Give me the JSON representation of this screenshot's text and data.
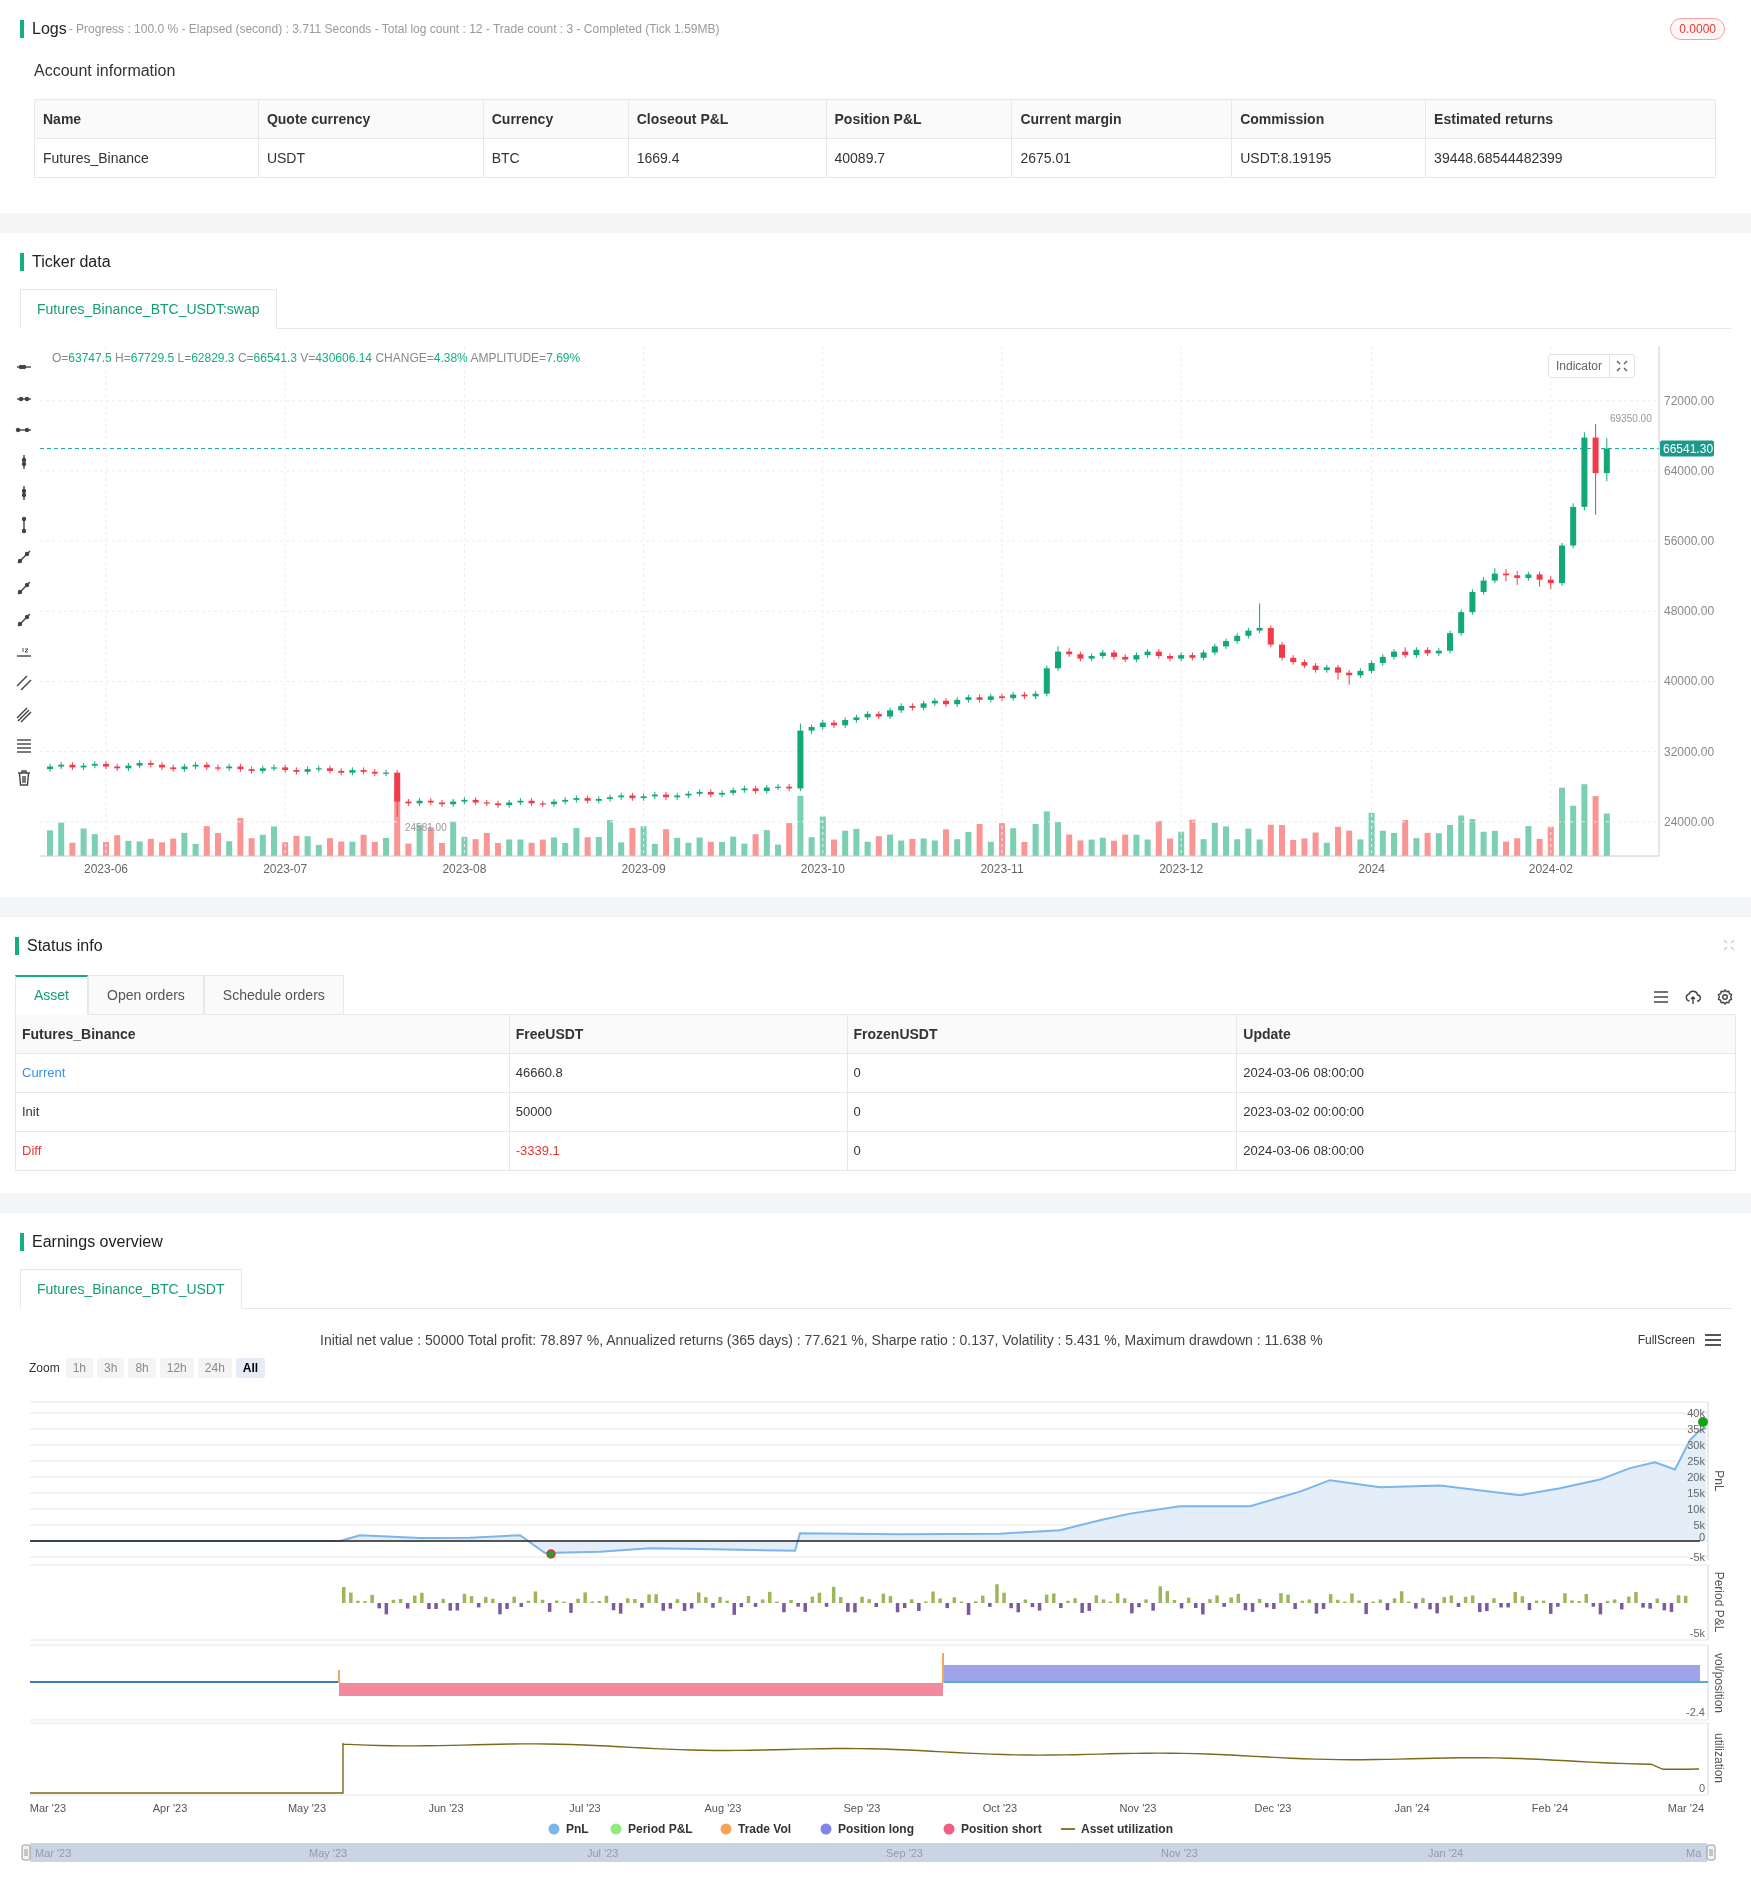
{
  "logs": {
    "title": "Logs",
    "summary": "- Progress : 100.0 % - Elapsed (second) : 3.711  Seconds - Total log count : 12 - Trade count : 3 - Completed (Tick 1.59MB)",
    "badge": "0.0000"
  },
  "account": {
    "title": "Account information",
    "columns": [
      "Name",
      "Quote currency",
      "Currency",
      "Closeout P&L",
      "Position P&L",
      "Current margin",
      "Commission",
      "Estimated returns"
    ],
    "rows": [
      [
        "Futures_Binance",
        "USDT",
        "BTC",
        "1669.4",
        "40089.7",
        "2675.01",
        "USDT:8.19195",
        "39448.68544482399"
      ]
    ]
  },
  "ticker": {
    "title": "Ticker data",
    "tabs": [
      {
        "label": "Futures_Binance_BTC_USDT:swap",
        "selected": true
      }
    ],
    "ohlc": [
      {
        "label": "O=",
        "value": "63747.5"
      },
      {
        "label": "H=",
        "value": "67729.5"
      },
      {
        "label": "L=",
        "value": "62829.3"
      },
      {
        "label": "C=",
        "value": "66541.3"
      },
      {
        "label": "V=",
        "value": "430606.14"
      },
      {
        "label": "CHANGE=",
        "value": "4.38%"
      },
      {
        "label": "AMPLITUDE=",
        "value": "7.69%"
      }
    ],
    "indicator_button": "Indicator",
    "last_price": "66541.30",
    "high_marker": "69350.00",
    "low_marker": "24581.00",
    "chart_data": {
      "type": "candlestick",
      "categories": [
        null,
        null,
        null,
        null,
        null,
        "2023-06",
        null,
        null,
        null,
        null,
        null,
        null,
        null,
        null,
        null,
        null,
        null,
        null,
        null,
        null,
        null,
        "2023-07",
        null,
        null,
        null,
        null,
        null,
        null,
        null,
        null,
        null,
        null,
        null,
        null,
        null,
        null,
        null,
        "2023-08",
        null,
        null,
        null,
        null,
        null,
        null,
        null,
        null,
        null,
        null,
        null,
        null,
        null,
        null,
        null,
        "2023-09",
        null,
        null,
        null,
        null,
        null,
        null,
        null,
        null,
        null,
        null,
        null,
        null,
        null,
        null,
        null,
        "2023-10",
        null,
        null,
        null,
        null,
        null,
        null,
        null,
        null,
        null,
        null,
        null,
        null,
        null,
        null,
        null,
        "2023-11",
        null,
        null,
        null,
        null,
        null,
        null,
        null,
        null,
        null,
        null,
        null,
        null,
        null,
        null,
        null,
        "2023-12",
        null,
        null,
        null,
        null,
        null,
        null,
        null,
        null,
        null,
        null,
        null,
        null,
        null,
        null,
        null,
        null,
        "2024",
        null,
        null,
        null,
        null,
        null,
        null,
        null,
        null,
        null,
        null,
        null,
        null,
        null,
        null,
        null,
        "2024-02",
        null,
        null,
        null,
        null,
        null
      ],
      "ylim": [
        20100,
        78240
      ],
      "grid": true,
      "yticks": [
        {
          "value": 72000,
          "label": "72000.00"
        },
        {
          "value": 64000,
          "label": "64000.00"
        },
        {
          "value": 56000,
          "label": "56000.00"
        },
        {
          "value": 48000,
          "label": "48000.00"
        },
        {
          "value": 40000,
          "label": "40000.00"
        },
        {
          "value": 32000,
          "label": "32000.00"
        },
        {
          "value": 24000,
          "label": "24000.00"
        }
      ],
      "ohlc": [
        [
          30000,
          30600,
          29700,
          30300
        ],
        [
          30300,
          30800,
          30000,
          30500
        ],
        [
          30500,
          30800,
          29900,
          30200
        ],
        [
          30200,
          30700,
          29900,
          30400
        ],
        [
          30400,
          30900,
          30100,
          30600
        ],
        [
          30600,
          30900,
          30000,
          30300
        ],
        [
          30300,
          30600,
          29800,
          30100
        ],
        [
          30100,
          30700,
          29800,
          30400
        ],
        [
          30400,
          31000,
          30100,
          30700
        ],
        [
          30700,
          31000,
          30200,
          30500
        ],
        [
          30500,
          30800,
          29900,
          30200
        ],
        [
          30200,
          30500,
          29700,
          30000
        ],
        [
          30000,
          30600,
          29700,
          30300
        ],
        [
          30300,
          30800,
          30000,
          30500
        ],
        [
          30500,
          30800,
          29900,
          30200
        ],
        [
          30200,
          30500,
          29800,
          30100
        ],
        [
          30100,
          30600,
          29800,
          30300
        ],
        [
          30300,
          30600,
          29700,
          30000
        ],
        [
          30000,
          30300,
          29500,
          29800
        ],
        [
          29800,
          30400,
          29500,
          30100
        ],
        [
          30100,
          30500,
          29800,
          30200
        ],
        [
          30200,
          30500,
          29600,
          29900
        ],
        [
          29900,
          30200,
          29400,
          29700
        ],
        [
          29700,
          30300,
          29400,
          30000
        ],
        [
          30000,
          30400,
          29700,
          30100
        ],
        [
          30100,
          30400,
          29500,
          29800
        ],
        [
          29800,
          30100,
          29300,
          29600
        ],
        [
          29600,
          30200,
          29300,
          29900
        ],
        [
          29900,
          30200,
          29400,
          29700
        ],
        [
          29700,
          30000,
          29200,
          29500
        ],
        [
          29500,
          29900,
          29200,
          29600
        ],
        [
          29600,
          29900,
          24581,
          26300
        ],
        [
          26300,
          26600,
          25800,
          26100
        ],
        [
          26100,
          26700,
          25800,
          26400
        ],
        [
          26400,
          26700,
          25900,
          26200
        ],
        [
          26200,
          26500,
          25700,
          26000
        ],
        [
          26000,
          26600,
          25700,
          26300
        ],
        [
          26300,
          26800,
          26000,
          26500
        ],
        [
          26500,
          26800,
          25900,
          26200
        ],
        [
          26200,
          26500,
          25800,
          26100
        ],
        [
          26100,
          26400,
          25600,
          25900
        ],
        [
          25900,
          26500,
          25600,
          26200
        ],
        [
          26200,
          26700,
          25900,
          26400
        ],
        [
          26400,
          26700,
          25800,
          26100
        ],
        [
          26100,
          26400,
          25700,
          26000
        ],
        [
          26000,
          26600,
          25700,
          26300
        ],
        [
          26300,
          26800,
          26000,
          26500
        ],
        [
          26500,
          27000,
          26200,
          26700
        ],
        [
          26700,
          27000,
          26100,
          26400
        ],
        [
          26400,
          26900,
          26100,
          26600
        ],
        [
          26600,
          27100,
          26300,
          26800
        ],
        [
          26800,
          27300,
          26500,
          27000
        ],
        [
          27000,
          27300,
          26400,
          26700
        ],
        [
          26700,
          27200,
          26400,
          26900
        ],
        [
          26900,
          27400,
          26600,
          27100
        ],
        [
          27100,
          27400,
          26500,
          26800
        ],
        [
          26800,
          27300,
          26500,
          27000
        ],
        [
          27000,
          27500,
          26700,
          27200
        ],
        [
          27200,
          27700,
          26900,
          27400
        ],
        [
          27400,
          27700,
          26800,
          27100
        ],
        [
          27100,
          27600,
          26800,
          27300
        ],
        [
          27300,
          27900,
          27000,
          27600
        ],
        [
          27600,
          28100,
          27300,
          27800
        ],
        [
          27800,
          28100,
          27200,
          27500
        ],
        [
          27500,
          28200,
          27200,
          27900
        ],
        [
          27900,
          28300,
          27600,
          28000
        ],
        [
          28000,
          28300,
          27500,
          27800
        ],
        [
          27800,
          35200,
          27500,
          34400
        ],
        [
          34400,
          35100,
          34000,
          34800
        ],
        [
          34800,
          35600,
          34500,
          35300
        ],
        [
          35300,
          35600,
          34700,
          35000
        ],
        [
          35000,
          35900,
          34700,
          35600
        ],
        [
          35600,
          36200,
          35300,
          35900
        ],
        [
          35900,
          36600,
          35600,
          36300
        ],
        [
          36300,
          36600,
          35700,
          36000
        ],
        [
          36000,
          37000,
          35700,
          36700
        ],
        [
          36700,
          37500,
          36400,
          37200
        ],
        [
          37200,
          37500,
          36700,
          37000
        ],
        [
          37000,
          37800,
          36700,
          37500
        ],
        [
          37500,
          38100,
          37200,
          37800
        ],
        [
          37800,
          38100,
          37100,
          37400
        ],
        [
          37400,
          38200,
          37100,
          37900
        ],
        [
          37900,
          38500,
          37600,
          38200
        ],
        [
          38200,
          38500,
          37600,
          37900
        ],
        [
          37900,
          38600,
          37600,
          38300
        ],
        [
          38300,
          38600,
          37800,
          38100
        ],
        [
          38100,
          38800,
          37800,
          38500
        ],
        [
          38500,
          38800,
          38000,
          38300
        ],
        [
          38300,
          38900,
          38000,
          38600
        ],
        [
          38600,
          41800,
          38300,
          41500
        ],
        [
          41500,
          44000,
          41200,
          43400
        ],
        [
          43400,
          43800,
          42800,
          43100
        ],
        [
          43100,
          43400,
          42300,
          42600
        ],
        [
          42600,
          43200,
          42300,
          42900
        ],
        [
          42900,
          43600,
          42600,
          43300
        ],
        [
          43300,
          43600,
          42500,
          42800
        ],
        [
          42800,
          43100,
          42200,
          42500
        ],
        [
          42500,
          43300,
          42200,
          43000
        ],
        [
          43000,
          43700,
          42700,
          43400
        ],
        [
          43400,
          43700,
          42600,
          42900
        ],
        [
          42900,
          43200,
          42300,
          42600
        ],
        [
          42600,
          43300,
          42300,
          43000
        ],
        [
          43000,
          43300,
          42400,
          42700
        ],
        [
          42700,
          43600,
          42400,
          43300
        ],
        [
          43300,
          44300,
          43000,
          44000
        ],
        [
          44000,
          44900,
          43700,
          44600
        ],
        [
          44600,
          45500,
          44300,
          45200
        ],
        [
          45200,
          46100,
          44900,
          45800
        ],
        [
          45800,
          48900,
          45500,
          46100
        ],
        [
          46100,
          46400,
          43900,
          44200
        ],
        [
          44200,
          44500,
          42400,
          42700
        ],
        [
          42700,
          43000,
          41900,
          42200
        ],
        [
          42200,
          42500,
          41500,
          41800
        ],
        [
          41800,
          42100,
          41000,
          41300
        ],
        [
          41300,
          41900,
          41000,
          41600
        ],
        [
          41600,
          41900,
          40200,
          41000
        ],
        [
          41000,
          41300,
          39600,
          40700
        ],
        [
          40700,
          41500,
          40400,
          41200
        ],
        [
          41200,
          42400,
          40900,
          42100
        ],
        [
          42100,
          43100,
          41800,
          42800
        ],
        [
          42800,
          43700,
          42500,
          43400
        ],
        [
          43400,
          43900,
          42700,
          43000
        ],
        [
          43000,
          43900,
          42700,
          43600
        ],
        [
          43600,
          43900,
          42900,
          43200
        ],
        [
          43200,
          43800,
          42900,
          43500
        ],
        [
          43500,
          45800,
          43200,
          45500
        ],
        [
          45500,
          48200,
          45200,
          47900
        ],
        [
          47900,
          50500,
          47600,
          50200
        ],
        [
          50200,
          51900,
          49900,
          51500
        ],
        [
          51500,
          52900,
          51200,
          52300
        ],
        [
          52300,
          52800,
          51400,
          52100
        ],
        [
          52100,
          52600,
          51000,
          51800
        ],
        [
          51800,
          52500,
          51500,
          52200
        ],
        [
          52200,
          52500,
          50800,
          51600
        ],
        [
          51600,
          52000,
          50500,
          51200
        ],
        [
          51200,
          55800,
          50900,
          55500
        ],
        [
          55500,
          60300,
          55200,
          59900
        ],
        [
          59900,
          68400,
          59500,
          67800
        ],
        [
          67800,
          69350,
          59000,
          63747.5
        ],
        [
          63747.5,
          67729.5,
          62829.3,
          66541.3
        ]
      ]
    }
  },
  "status": {
    "title": "Status info",
    "tabs": [
      {
        "label": "Asset",
        "selected": true
      },
      {
        "label": "Open orders",
        "selected": false
      },
      {
        "label": "Schedule orders",
        "selected": false
      }
    ],
    "columns": [
      "Futures_Binance",
      "FreeUSDT",
      "FrozenUSDT",
      "Update"
    ],
    "rows": [
      {
        "kind": "current",
        "cells": [
          "Current",
          "46660.8",
          "0",
          "2024-03-06 08:00:00"
        ]
      },
      {
        "kind": "init",
        "cells": [
          "Init",
          "50000",
          "0",
          "2023-03-02 00:00:00"
        ]
      },
      {
        "kind": "diff",
        "cells": [
          "Diff",
          "-3339.1",
          "0",
          "2024-03-06 08:00:00"
        ]
      }
    ]
  },
  "earnings": {
    "title": "Earnings overview",
    "tabs": [
      {
        "label": "Futures_Binance_BTC_USDT",
        "selected": true
      }
    ],
    "summary": "Initial net value : 50000 Total profit: 78.897 %, Annualized returns (365 days) : 77.621 %, Sharpe ratio : 0.137, Volatility : 5.431 %, Maximum drawdown : 11.638 %",
    "fullscreen": "FullScreen",
    "zoom_label": "Zoom",
    "zoom_buttons": [
      {
        "label": "1h",
        "selected": false
      },
      {
        "label": "3h",
        "selected": false
      },
      {
        "label": "8h",
        "selected": false
      },
      {
        "label": "12h",
        "selected": false
      },
      {
        "label": "24h",
        "selected": false
      },
      {
        "label": "All",
        "selected": true
      }
    ],
    "pnl_axis": [
      "40k",
      "35k",
      "30k",
      "25k",
      "20k",
      "15k",
      "10k",
      "5k",
      "0",
      "-5k"
    ],
    "pnl_title": "PnL",
    "period_axis": [
      "-5k"
    ],
    "period_title": "Period P&L",
    "position_axis": [
      "-2.4"
    ],
    "position_title": "vol/position",
    "util_axis": [
      "0"
    ],
    "util_title": "utilization",
    "date_axis": [
      "Mar '23",
      "Apr '23",
      "May '23",
      "Jun '23",
      "Jul '23",
      "Aug '23",
      "Sep '23",
      "Oct '23",
      "Nov '23",
      "Dec '23",
      "Jan '24",
      "Feb '24",
      "Mar '24"
    ],
    "legend": [
      {
        "label": "PnL",
        "color": "#7cb5ec",
        "kind": "dot"
      },
      {
        "label": "Period P&L",
        "color": "#90ed7d",
        "kind": "dot"
      },
      {
        "label": "Trade Vol",
        "color": "#f7a35c",
        "kind": "dot"
      },
      {
        "label": "Position long",
        "color": "#8085e9",
        "kind": "dot"
      },
      {
        "label": "Position short",
        "color": "#f15c80",
        "kind": "dot"
      },
      {
        "label": "Asset utilization",
        "color": "#8d7a2a",
        "kind": "line"
      }
    ],
    "navigator_axis": [
      "Mar '23",
      "May '23",
      "Jul '23",
      "Sep '23",
      "Nov '23",
      "Jan '24",
      "Ma"
    ]
  }
}
